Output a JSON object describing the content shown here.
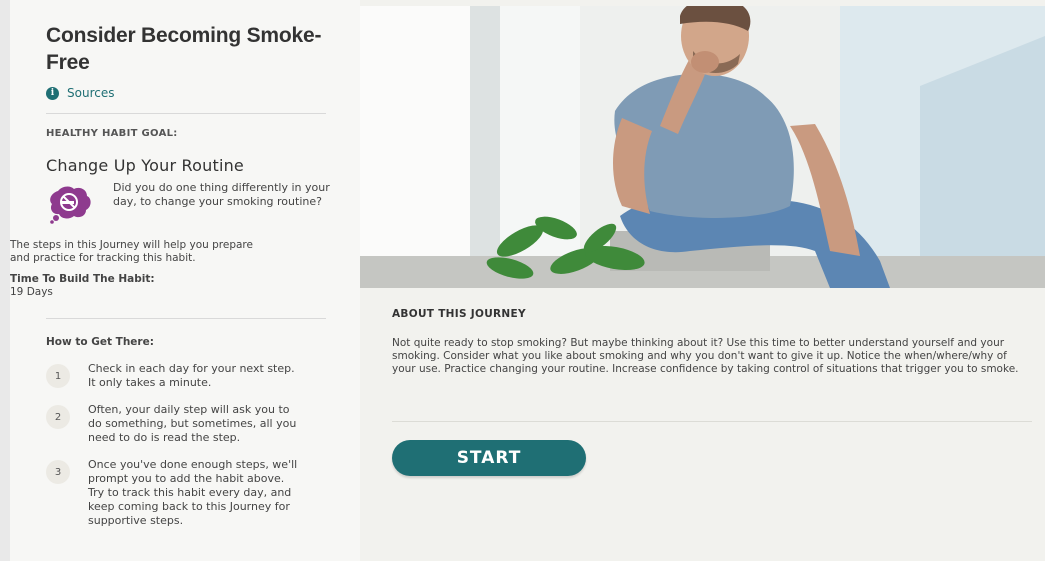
{
  "sidebar": {
    "title": "Consider Becoming Smoke-Free",
    "sources_label": "Sources",
    "goal_label": "HEALTHY HABIT GOAL:",
    "goal_title": "Change Up Your Routine",
    "goal_question": "Did you do one thing differently in your day, to change your smoking routine?",
    "description": "The steps in this Journey will help you prepare and practice for tracking this habit.",
    "time_label": "Time To Build The Habit:",
    "time_value": "19 Days",
    "how_label": "How to Get There:",
    "steps": [
      {
        "num": "1",
        "text": "Check in each day for your next step. It only takes a minute."
      },
      {
        "num": "2",
        "text": "Often, your daily step will ask you to do something, but sometimes, all you need to do is read the step."
      },
      {
        "num": "3",
        "text": "Once you've done enough steps, we'll prompt you to add the habit above. Try to track this habit every day, and keep coming back to this Journey for supportive steps."
      }
    ]
  },
  "main": {
    "about_label": "ABOUT THIS JOURNEY",
    "about_text": "Not quite ready to stop smoking? But maybe thinking about it? Use this time to better understand yourself and your smoking. Consider what you like about smoking and why you don't want to give it up. Notice the when/where/why of your use. Practice changing your routine. Increase confidence by taking control of situations that trigger you to smoke.",
    "start_label": "START"
  },
  "icons": {
    "info": "info-icon",
    "goal": "no-smoking-icon"
  },
  "colors": {
    "accent": "#1f6f74",
    "goal_icon": "#8e3a8e",
    "sidebar_bg": "#f7f7f5",
    "main_bg": "#f2f2ee"
  }
}
